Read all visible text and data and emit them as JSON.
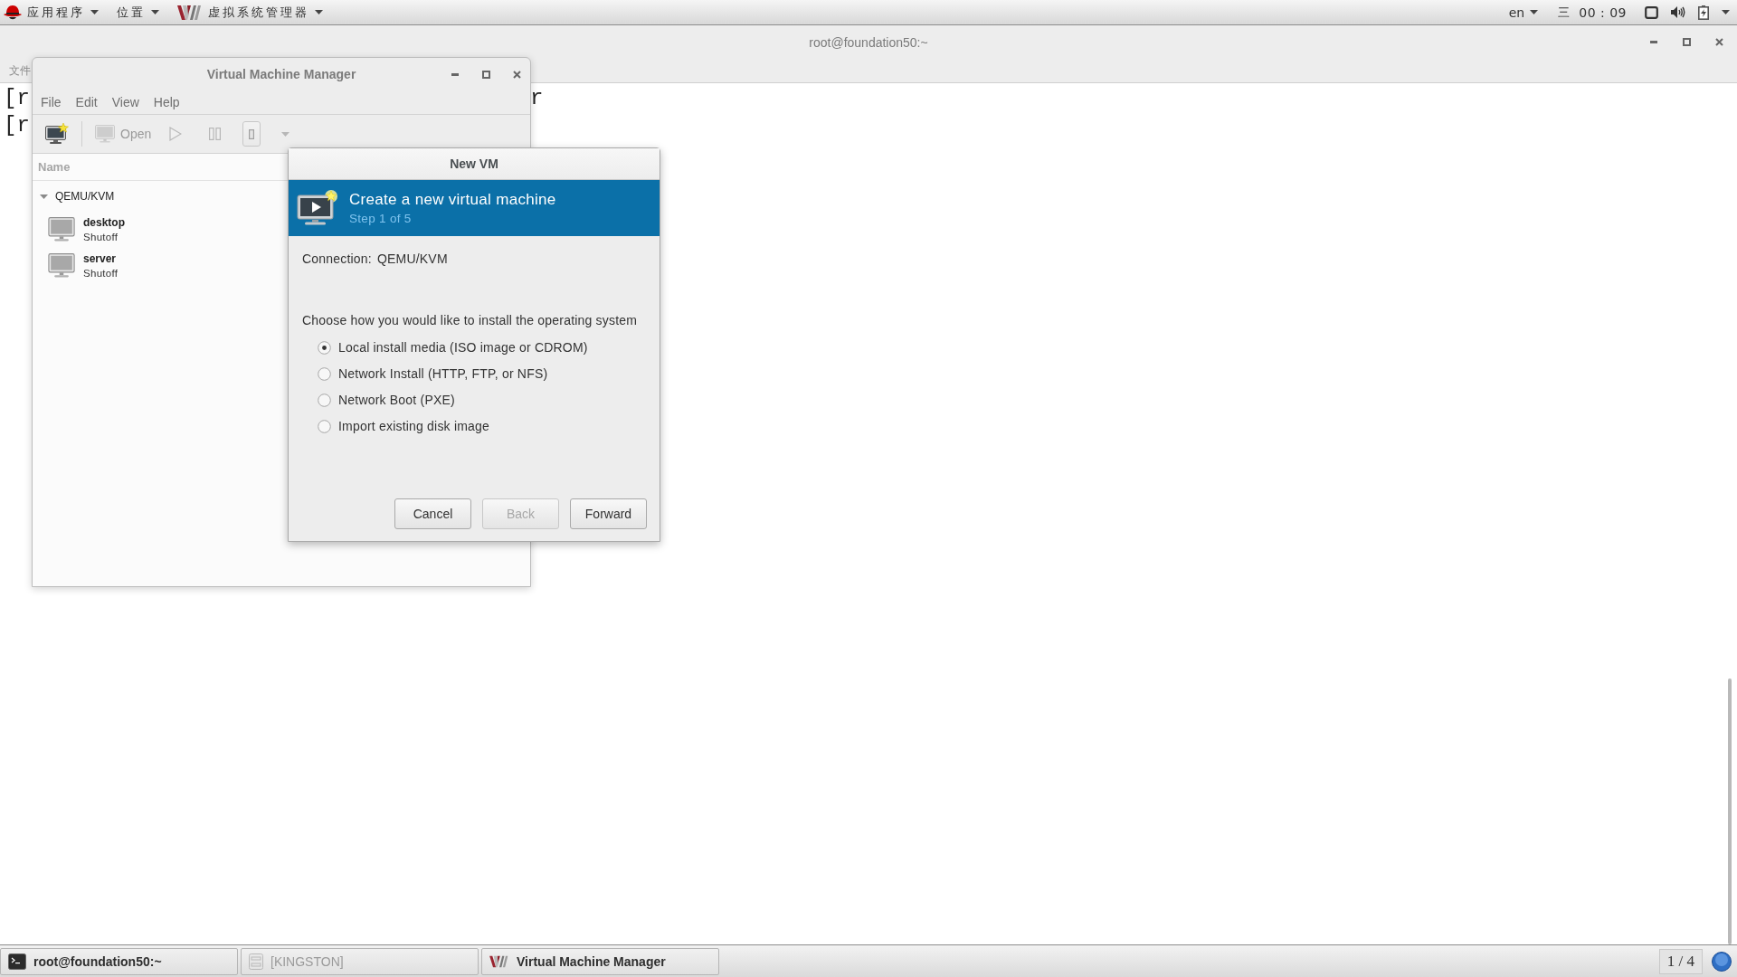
{
  "top_bar": {
    "menus": [
      {
        "kind": "applications",
        "label": "应用程序"
      },
      {
        "kind": "places",
        "label": "位置"
      },
      {
        "kind": "window",
        "label": "虚拟系统管理器"
      }
    ],
    "language": "en",
    "weekday": "三",
    "clock": "00 : 09"
  },
  "terminal": {
    "title": "root@foundation50:~",
    "menu": "文件",
    "lines": [
      {
        "fragments": [
          "[r",
          "r"
        ]
      },
      {
        "fragments": [
          "[r"
        ]
      }
    ]
  },
  "vmm_window": {
    "title": "Virtual Machine Manager",
    "menus": [
      "File",
      "Edit",
      "View",
      "Help"
    ],
    "toolbar": [
      {
        "kind": "new",
        "disabled": false
      },
      {
        "kind": "separator"
      },
      {
        "kind": "open",
        "label": "Open",
        "disabled": true
      },
      {
        "kind": "run",
        "disabled": true
      },
      {
        "kind": "pause",
        "disabled": true
      },
      {
        "kind": "shutdown",
        "disabled": true
      },
      {
        "kind": "dropdown",
        "disabled": true
      }
    ],
    "column": "Name",
    "connections": [
      {
        "name": "QEMU/KVM",
        "expanded": true,
        "children": [
          {
            "name": "desktop",
            "status": "Shutoff"
          },
          {
            "name": "server",
            "status": "Shutoff"
          }
        ]
      }
    ]
  },
  "new_vm_dialog": {
    "title": "New VM",
    "banner": {
      "title": "Create a new virtual machine",
      "step": "Step 1 of 5"
    },
    "connection_label": "Connection:",
    "connection_value": "QEMU/KVM",
    "prompt": "Choose how you would like to install the operating system",
    "options": [
      {
        "label": "Local install media (ISO image or CDROM)",
        "selected": true
      },
      {
        "label": "Network Install (HTTP, FTP, or NFS)",
        "selected": false
      },
      {
        "label": "Network Boot (PXE)",
        "selected": false
      },
      {
        "label": "Import existing disk image",
        "selected": false
      }
    ],
    "buttons": [
      {
        "label": "Cancel",
        "disabled": false
      },
      {
        "label": "Back",
        "disabled": true
      },
      {
        "label": "Forward",
        "disabled": false
      }
    ]
  },
  "taskbar": {
    "tasks": [
      {
        "kind": "terminal",
        "label": "root@foundation50:~",
        "minimized": false
      },
      {
        "kind": "drive",
        "label": "[KINGSTON]",
        "minimized": true
      },
      {
        "kind": "vmm",
        "label": "Virtual Machine Manager",
        "minimized": false
      }
    ],
    "workspace": "1 / 4"
  }
}
